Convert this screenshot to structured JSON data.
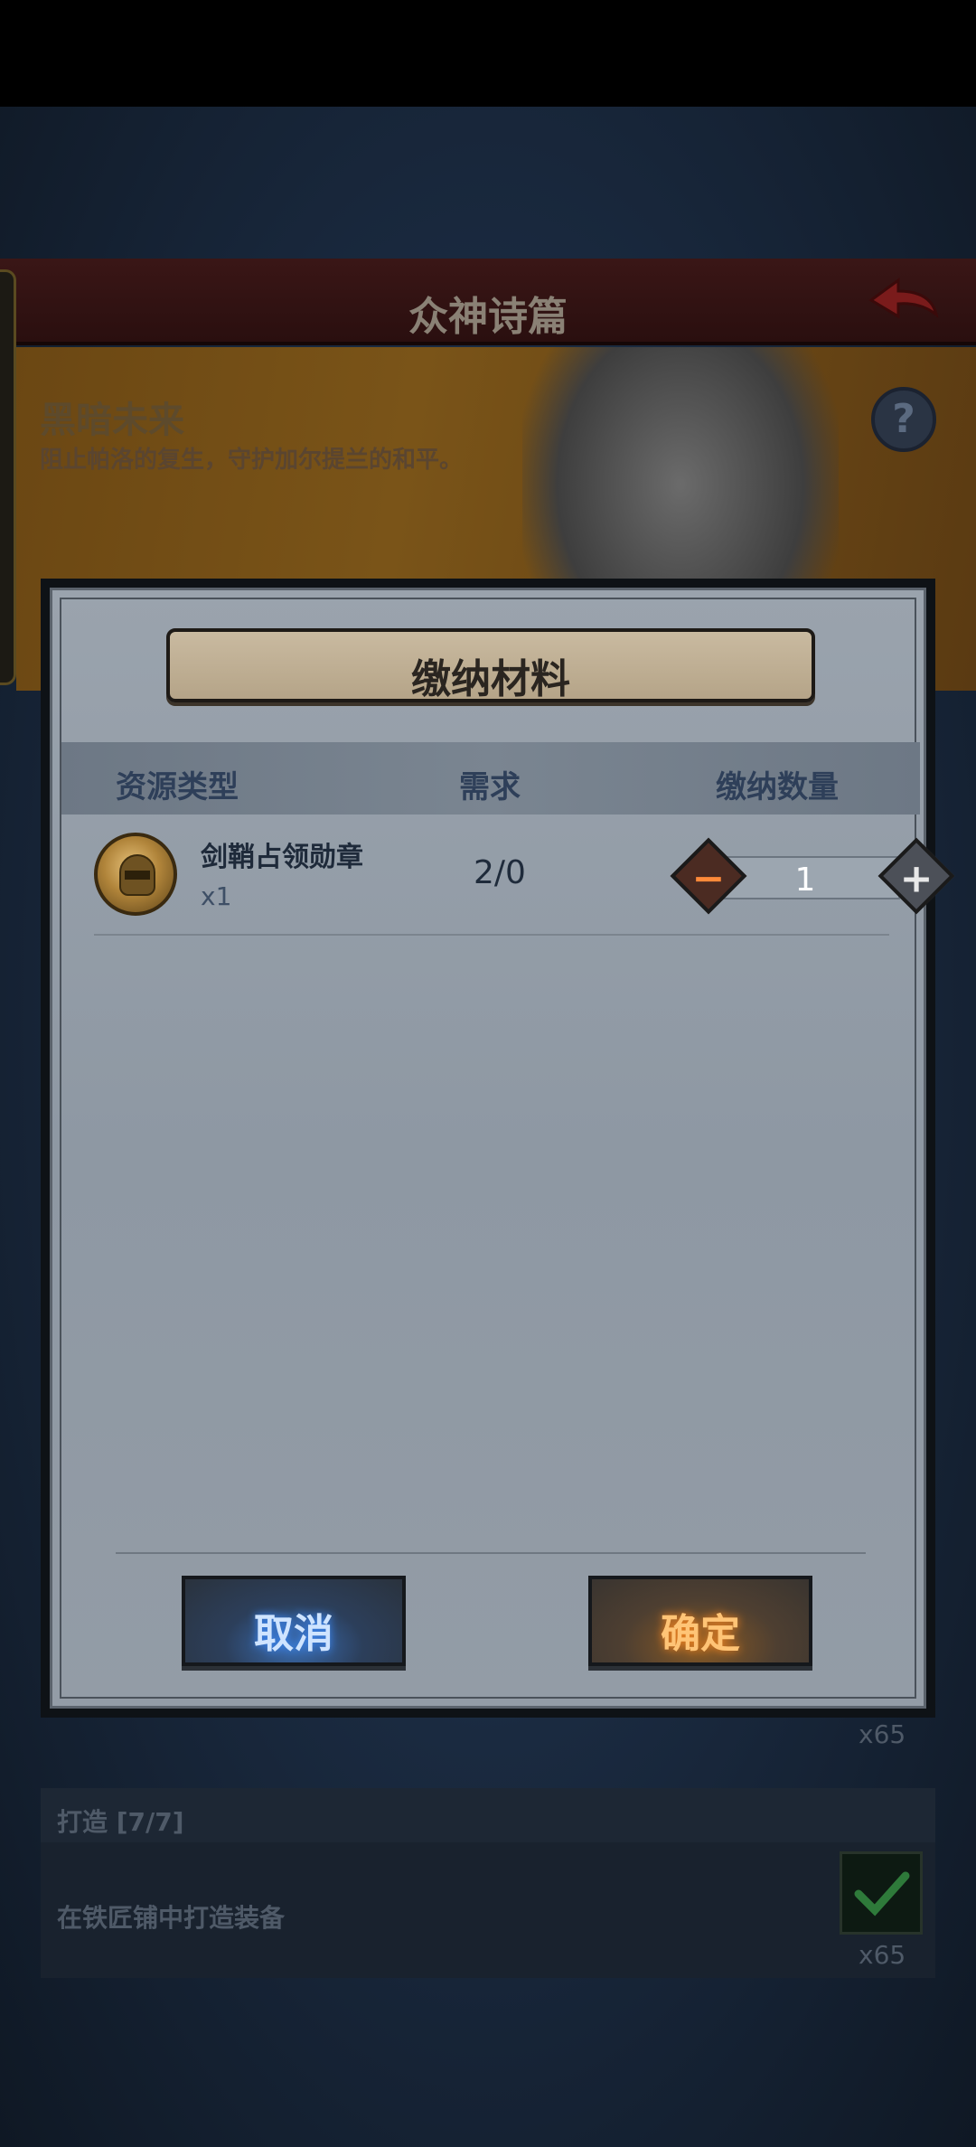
{
  "background": {
    "title": "众神诗篇",
    "banner": {
      "title": "黑暗未来",
      "subtitle": "阻止帕洛的复生，守护加尔提兰的和平。"
    },
    "task": {
      "title": "打造 [7/7]",
      "description": "在铁匠铺中打造装备",
      "reward_count": "x65"
    },
    "upper_reward_count": "x65"
  },
  "modal": {
    "title": "缴纳材料",
    "columns": {
      "resource_type": "资源类型",
      "requirement": "需求",
      "submit_quantity": "缴纳数量"
    },
    "items": [
      {
        "name": "剑鞘占领勋章",
        "owned": "x1",
        "requirement": "2/0",
        "quantity": "1",
        "icon": "knight-helmet-medal-icon"
      }
    ],
    "stepper": {
      "minus_symbol": "−",
      "plus_symbol": "+"
    },
    "cancel_label": "取消",
    "confirm_label": "确定"
  },
  "colors": {
    "cancel_glow": "#3c8cff",
    "confirm_glow": "#ff8a20",
    "column_header": "#2e3f59"
  }
}
